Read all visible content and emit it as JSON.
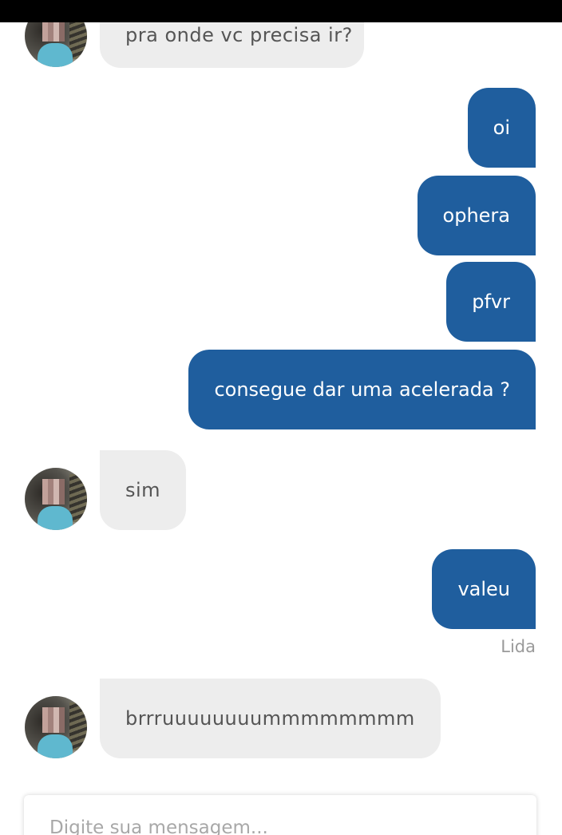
{
  "conversation": {
    "incoming": [
      {
        "text": "pra onde vc precisa ir?"
      },
      {
        "text": "sim"
      },
      {
        "text": "brrruuuuuuuummmmmmmm"
      }
    ],
    "outgoing": [
      {
        "text": "oi"
      },
      {
        "text": "ophera"
      },
      {
        "text": "pfvr"
      },
      {
        "text": "consegue dar uma acelerada ?"
      },
      {
        "text": "valeu"
      }
    ],
    "read_status": "Lida"
  },
  "composer": {
    "placeholder": "Digite sua mensagem..."
  },
  "colors": {
    "outgoing_bubble": "#1f5e9e",
    "incoming_bubble": "#ededed",
    "status_bar": "#000000"
  }
}
